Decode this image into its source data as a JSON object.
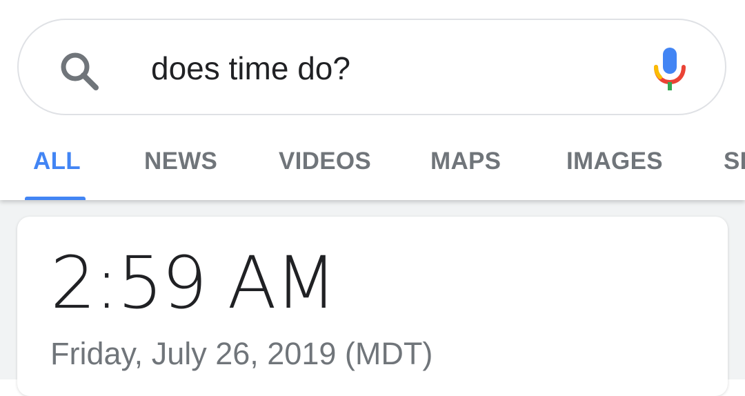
{
  "search": {
    "query": "does time do?",
    "search_icon": "search-icon",
    "mic_icon": "mic-icon"
  },
  "tabs": [
    {
      "label": "ALL",
      "active": true
    },
    {
      "label": "NEWS",
      "active": false
    },
    {
      "label": "VIDEOS",
      "active": false
    },
    {
      "label": "MAPS",
      "active": false
    },
    {
      "label": "IMAGES",
      "active": false
    },
    {
      "label": "SHOPPING",
      "active": false
    }
  ],
  "result": {
    "time": "2:59 AM",
    "date": "Friday, July 26, 2019 (MDT)"
  },
  "colors": {
    "accent": "#4285f4",
    "tab_inactive": "#70757a",
    "text_primary": "#202124"
  }
}
